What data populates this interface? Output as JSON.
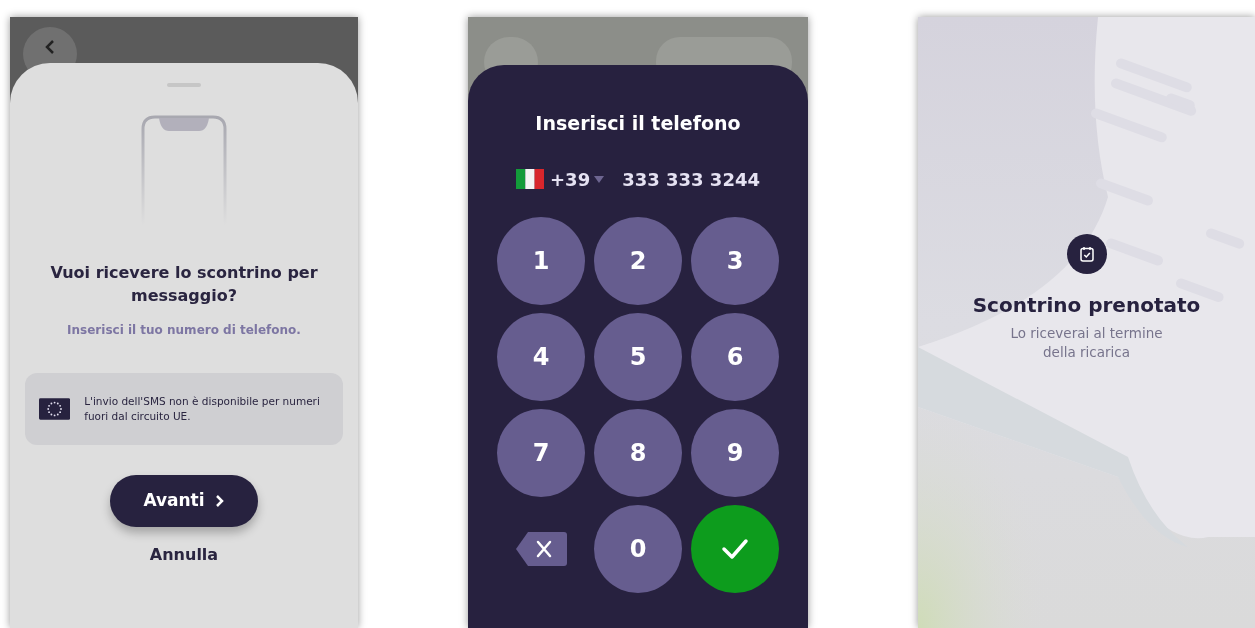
{
  "sms_prompt": {
    "title": "Vuoi ricevere lo scontrino per messaggio?",
    "subtitle": "Inserisci il tuo numero di telefono.",
    "notice": "L'invio dell'SMS non è disponibile per numeri fuori dal circuito UE.",
    "primary_button": "Avanti",
    "secondary_button": "Annulla"
  },
  "phone_entry": {
    "title": "Inserisci il telefono",
    "country_code": "+39",
    "phone_number": "333 333 3244",
    "keys": [
      {
        "kind": "digit",
        "label": "1"
      },
      {
        "kind": "digit",
        "label": "2"
      },
      {
        "kind": "digit",
        "label": "3"
      },
      {
        "kind": "digit",
        "label": "4"
      },
      {
        "kind": "digit",
        "label": "5"
      },
      {
        "kind": "digit",
        "label": "6"
      },
      {
        "kind": "digit",
        "label": "7"
      },
      {
        "kind": "digit",
        "label": "8"
      },
      {
        "kind": "digit",
        "label": "9"
      },
      {
        "kind": "delete"
      },
      {
        "kind": "digit",
        "label": "0"
      },
      {
        "kind": "confirm"
      }
    ]
  },
  "confirmation": {
    "title": "Scontrino prenotato",
    "message": "Lo riceverai al termine della ricarica"
  }
}
